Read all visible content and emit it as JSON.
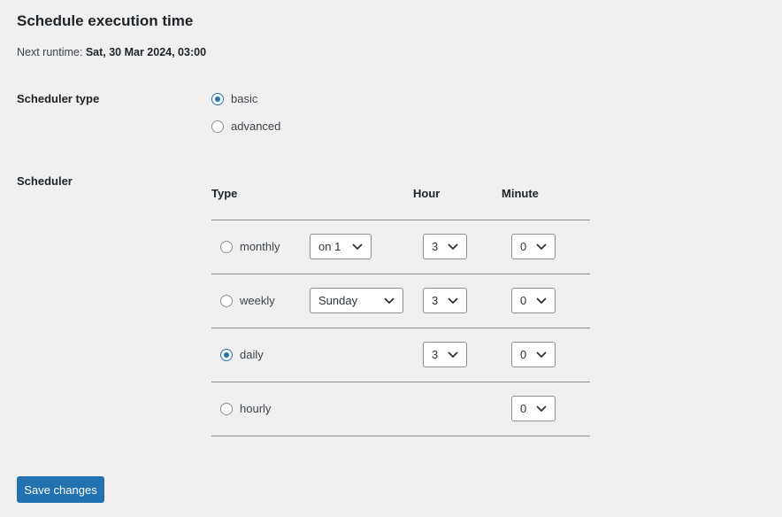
{
  "page": {
    "title": "Schedule execution time",
    "next_runtime_label": "Next runtime:",
    "next_runtime_value": "Sat, 30 Mar 2024, 03:00"
  },
  "scheduler_type": {
    "label": "Scheduler type",
    "options": [
      {
        "label": "basic",
        "checked": true
      },
      {
        "label": "advanced",
        "checked": false
      }
    ]
  },
  "scheduler": {
    "label": "Scheduler",
    "columns": [
      "Type",
      "Hour",
      "Minute"
    ],
    "rows": [
      {
        "type": "monthly",
        "checked": false,
        "extra": "on 1",
        "hour": "3",
        "minute": "0"
      },
      {
        "type": "weekly",
        "checked": false,
        "extra": "Sunday",
        "hour": "3",
        "minute": "0"
      },
      {
        "type": "daily",
        "checked": true,
        "extra": null,
        "hour": "3",
        "minute": "0"
      },
      {
        "type": "hourly",
        "checked": false,
        "extra": null,
        "hour": null,
        "minute": "0"
      }
    ]
  },
  "actions": {
    "save_label": "Save changes"
  },
  "colors": {
    "accent": "#2271b1",
    "background": "#f0f0f1"
  }
}
